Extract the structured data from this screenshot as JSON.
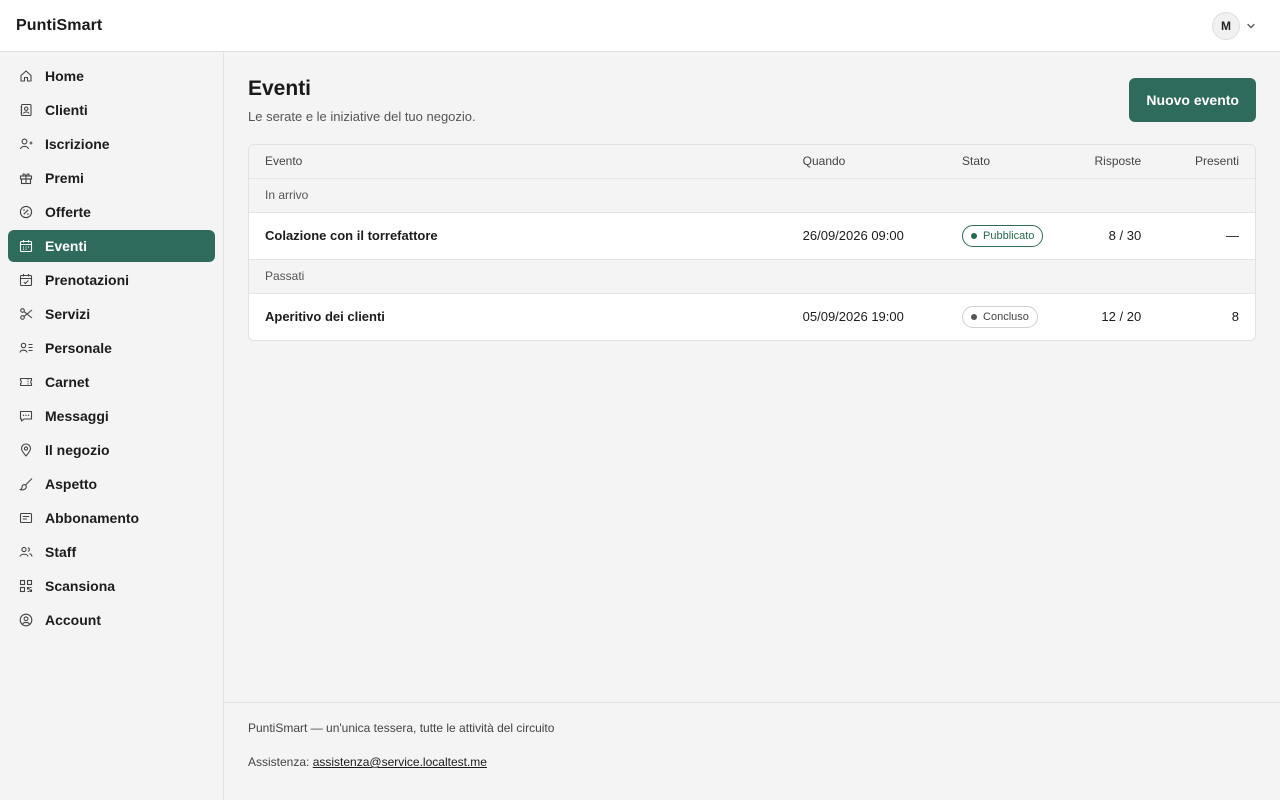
{
  "app": {
    "brand": "PuntiSmart",
    "user_initial": "M"
  },
  "sidebar": {
    "items": [
      {
        "label": "Home",
        "icon": "home-icon"
      },
      {
        "label": "Clienti",
        "icon": "contacts-icon"
      },
      {
        "label": "Iscrizione",
        "icon": "user-plus-icon"
      },
      {
        "label": "Premi",
        "icon": "gift-icon"
      },
      {
        "label": "Offerte",
        "icon": "percent-badge-icon"
      },
      {
        "label": "Eventi",
        "icon": "calendar-icon",
        "active": true
      },
      {
        "label": "Prenotazioni",
        "icon": "calendar-check-icon"
      },
      {
        "label": "Servizi",
        "icon": "scissors-icon"
      },
      {
        "label": "Personale",
        "icon": "user-list-icon"
      },
      {
        "label": "Carnet",
        "icon": "ticket-icon"
      },
      {
        "label": "Messaggi",
        "icon": "message-icon"
      },
      {
        "label": "Il negozio",
        "icon": "map-pin-icon"
      },
      {
        "label": "Aspetto",
        "icon": "brush-icon"
      },
      {
        "label": "Abbonamento",
        "icon": "receipt-icon"
      },
      {
        "label": "Staff",
        "icon": "users-icon"
      },
      {
        "label": "Scansiona",
        "icon": "qr-icon"
      },
      {
        "label": "Account",
        "icon": "user-circle-icon"
      }
    ]
  },
  "main": {
    "title": "Eventi",
    "subtitle": "Le serate e le iniziative del tuo negozio.",
    "new_button": "Nuovo evento",
    "table": {
      "headers": {
        "evento": "Evento",
        "quando": "Quando",
        "stato": "Stato",
        "risposte": "Risposte",
        "presenti": "Presenti"
      },
      "groups": [
        {
          "label": "In arrivo",
          "rows": [
            {
              "evento": "Colazione con il torrefattore",
              "quando": "26/09/2026 09:00",
              "stato": "Pubblicato",
              "risposte": "8 / 30",
              "presenti": "—"
            }
          ]
        },
        {
          "label": "Passati",
          "rows": [
            {
              "evento": "Aperitivo dei clienti",
              "quando": "05/09/2026 19:00",
              "stato": "Concluso",
              "risposte": "12 / 20",
              "presenti": "8"
            }
          ]
        }
      ]
    }
  },
  "footer": {
    "tagline": "PuntiSmart — un'unica tessera, tutte le attività del circuito",
    "support_label": "Assistenza:",
    "support_email": "assistenza@service.localtest.me"
  },
  "colors": {
    "accent": "#2f6b5c",
    "badge_published": "#246b4c"
  }
}
